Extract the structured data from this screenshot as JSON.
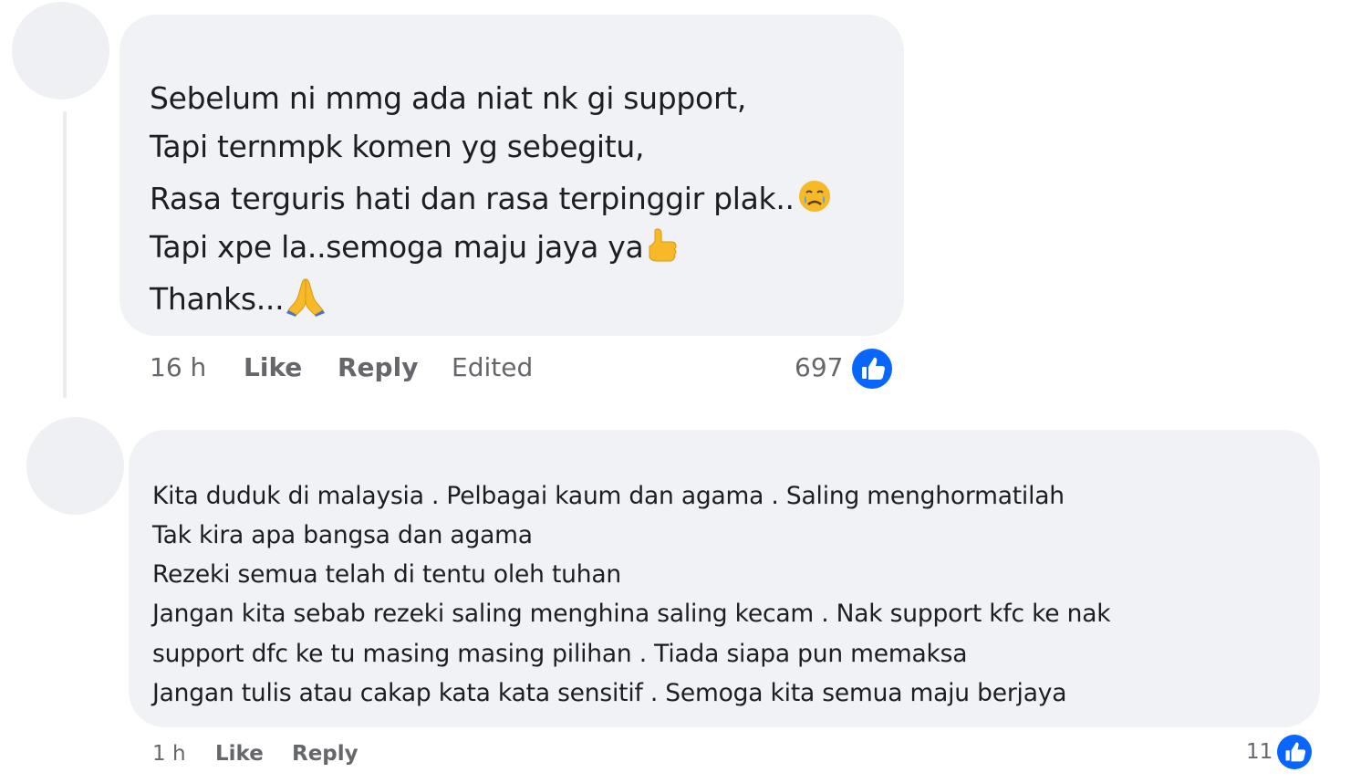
{
  "comments": [
    {
      "lines": [
        "Sebelum ni mmg ada niat nk gi support,",
        "Tapi ternmpk komen yg sebegitu,",
        "Rasa terguris hati dan rasa terpinggir plak..",
        "Tapi xpe la..semoga maju jaya ya",
        "Thanks..."
      ],
      "line_emojis": [
        "",
        "",
        "crying-face-emoji",
        "thumbs-up-emoji",
        "folded-hands-emoji"
      ],
      "time": "16 h",
      "like_label": "Like",
      "reply_label": "Reply",
      "edited_label": "Edited",
      "reaction_count": "697",
      "reaction_icon": "like-reaction-icon"
    },
    {
      "lines": [
        "Kita duduk di malaysia . Pelbagai kaum dan agama . Saling menghormatilah",
        "Tak kira apa bangsa dan agama",
        "Rezeki semua telah di tentu oleh tuhan",
        "Jangan kita sebab rezeki saling menghina saling kecam . Nak support kfc ke nak",
        "support dfc ke tu masing masing pilihan . Tiada siapa pun memaksa",
        "Jangan tulis atau cakap kata kata sensitif . Semoga kita semua maju berjaya"
      ],
      "time": "1 h",
      "like_label": "Like",
      "reply_label": "Reply",
      "reaction_count": "11",
      "reaction_icon": "like-reaction-icon"
    }
  ],
  "colors": {
    "bubble": "#f0f2f5",
    "avatar": "#eef0f4",
    "meta_text": "#65676b",
    "like_blue": "#0866ff",
    "emoji_yellow": "#f7b928"
  }
}
